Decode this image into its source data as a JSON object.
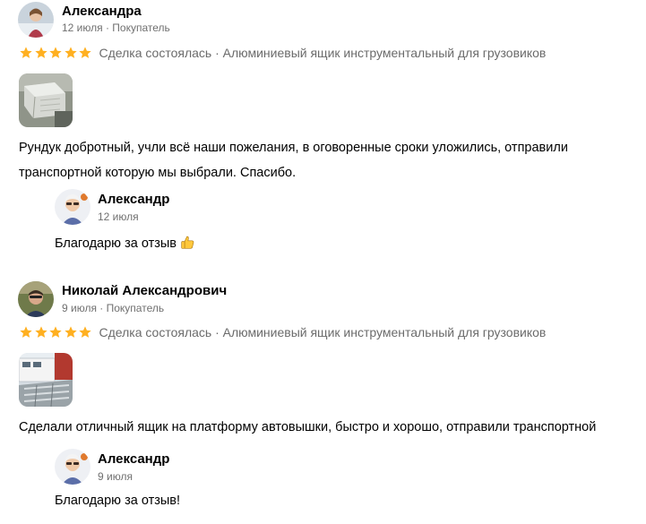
{
  "reviews": [
    {
      "author": "Александра",
      "date": "12 июля",
      "role": "Покупатель",
      "rating": 5,
      "deal_info": "Сделка состоялась · Алюминиевый ящик инструментальный для грузовиков",
      "text": "Рундук добротный, учли всё наши пожелания, в оговоренные сроки уложились, отправили транспортной которую мы выбрали. Спасибо.",
      "reply": {
        "author": "Александр",
        "date": "12 июля",
        "text": "Благодарю за отзыв",
        "emoji": "thumbs-up-icon"
      }
    },
    {
      "author": "Николай Александрович",
      "date": "9 июля",
      "role": "Покупатель",
      "rating": 5,
      "deal_info": "Сделка состоялась · Алюминиевый ящик инструментальный для грузовиков",
      "text": "Сделали отличный ящик на платформу автовышки, быстро и хорошо, отправили транспортной",
      "reply": {
        "author": "Александр",
        "date": "9 июля",
        "text": "Благодарю за отзыв!"
      }
    }
  ],
  "colors": {
    "star": "#FFB021",
    "meta_text": "#707070",
    "deal_text": "#6b6b6b"
  }
}
